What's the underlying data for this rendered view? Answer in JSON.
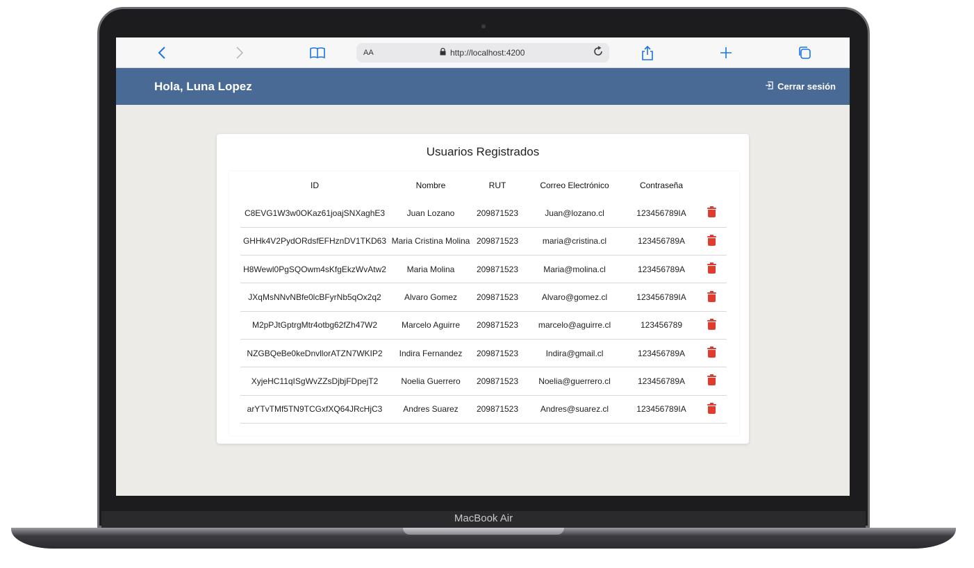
{
  "device": {
    "label": "MacBook Air"
  },
  "browser": {
    "text_size_label": "AA",
    "url": "http://localhost:4200",
    "icons": [
      "back-icon",
      "forward-icon",
      "bookmarks-icon",
      "lock-icon",
      "reload-icon",
      "share-icon",
      "new-tab-icon",
      "tabs-icon"
    ]
  },
  "header": {
    "greeting": "Hola, Luna Lopez",
    "logout_label": "Cerrar sesión",
    "color": "#4a6a96"
  },
  "card": {
    "title": "Usuarios Registrados"
  },
  "table": {
    "columns": [
      "ID",
      "Nombre",
      "RUT",
      "Correo Electrónico",
      "Contraseña"
    ],
    "rows": [
      {
        "id": "C8EVG1W3w0OKaz61joajSNXaghE3",
        "nombre": "Juan Lozano",
        "rut": "209871523",
        "correo": "Juan@lozano.cl",
        "contrasena": "123456789IA"
      },
      {
        "id": "GHHk4V2PydORdsfEFHznDV1TKD63",
        "nombre": "Maria Cristina Molina",
        "rut": "209871523",
        "correo": "maria@cristina.cl",
        "contrasena": "123456789A"
      },
      {
        "id": "H8Wewl0PgSQOwm4sKfgEkzWvAtw2",
        "nombre": "Maria Molina",
        "rut": "209871523",
        "correo": "Maria@molina.cl",
        "contrasena": "123456789A"
      },
      {
        "id": "JXqMsNNvNBfe0lcBFyrNb5qOx2q2",
        "nombre": "Alvaro Gomez",
        "rut": "209871523",
        "correo": "Alvaro@gomez.cl",
        "contrasena": "123456789IA"
      },
      {
        "id": "M2pPJtGptrgMtr4otbg62fZh47W2",
        "nombre": "Marcelo Aguirre",
        "rut": "209871523",
        "correo": "marcelo@aguirre.cl",
        "contrasena": "123456789"
      },
      {
        "id": "NZGBQeBe0keDnvllorATZN7WKIP2",
        "nombre": "Indira Fernandez",
        "rut": "209871523",
        "correo": "Indira@gmail.cl",
        "contrasena": "123456789A"
      },
      {
        "id": "XyjeHC11qISgWvZZsDjbjFDpejT2",
        "nombre": "Noelia Guerrero",
        "rut": "209871523",
        "correo": "Noelia@guerrero.cl",
        "contrasena": "123456789A"
      },
      {
        "id": "arYTvTMf5TN9TCGxfXQ64JRcHjC3",
        "nombre": "Andres Suarez",
        "rut": "209871523",
        "correo": "Andres@suarez.cl",
        "contrasena": "123456789IA"
      }
    ],
    "delete_color": "#e03b2f"
  }
}
